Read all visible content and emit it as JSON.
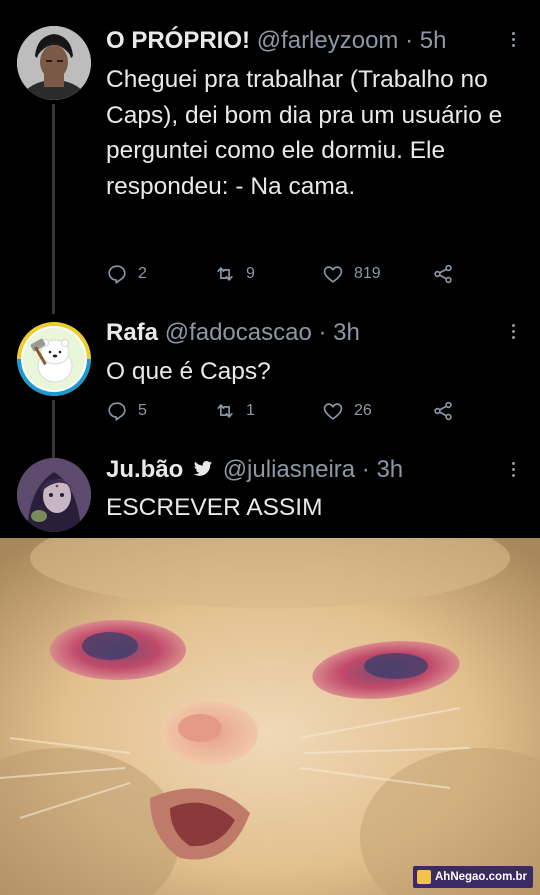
{
  "tweets": [
    {
      "name": "O PRÓPRIO!",
      "handle": "@farleyzoom",
      "sep": "·",
      "time": "5h",
      "text": "Cheguei pra trabalhar (Trabalho no Caps), dei bom dia pra um usuário e perguntei como ele dormiu. Ele respondeu: - Na cama.",
      "replies": "2",
      "retweets": "9",
      "likes": "819"
    },
    {
      "name": "Rafa",
      "handle": "@fadocascao",
      "sep": "·",
      "time": "3h",
      "text": "O que é Caps?",
      "replies": "5",
      "retweets": "1",
      "likes": "26"
    },
    {
      "name": "Ju.bão",
      "handle": "@juliasneira",
      "sep": "·",
      "time": "3h",
      "text": "ESCREVER ASSIM"
    }
  ],
  "watermark": "AhNegao.com.br",
  "colors": {
    "background": "#000000",
    "text": "#e7e9ea",
    "secondary": "#8b98a5",
    "thread_line": "#333639",
    "watermark_bg": "#3b2a63"
  },
  "icons": [
    "more-icon",
    "reply-icon",
    "retweet-icon",
    "like-icon",
    "share-icon",
    "bird-icon"
  ]
}
